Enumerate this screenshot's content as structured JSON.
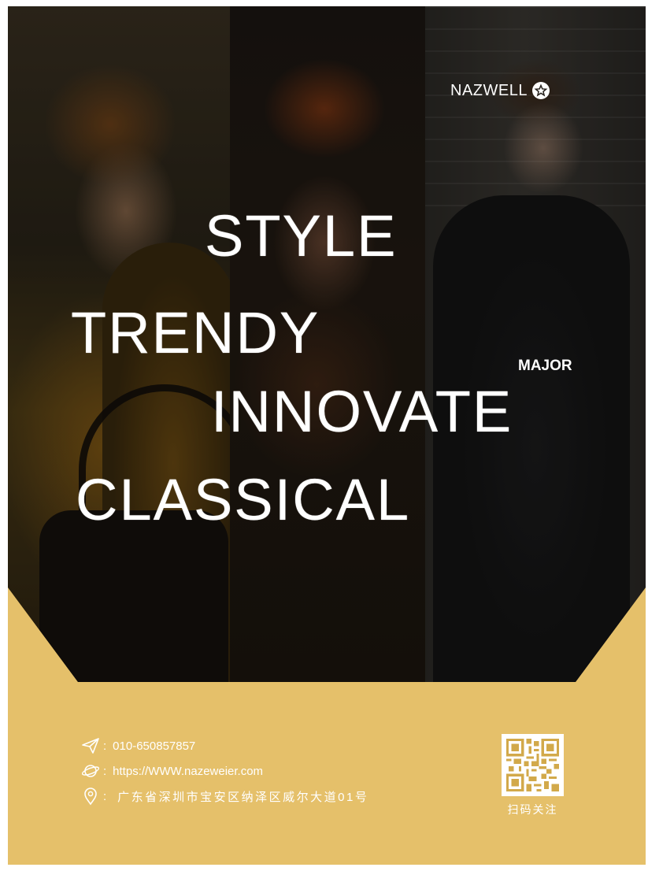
{
  "brand": {
    "name": "NAZWELL",
    "logo_icon": "star-badge-icon"
  },
  "headline": {
    "word_1": "STYLE",
    "word_2": "TRENDY",
    "word_3": "INNOVATE",
    "word_4": "CLASSICAL",
    "tag": "MAJOR"
  },
  "contact": {
    "separator": ":",
    "phone": {
      "icon": "paper-plane-icon",
      "text": "010-650857857"
    },
    "website": {
      "icon": "globe-icon",
      "text": "https://WWW.nazeweier.com"
    },
    "address": {
      "icon": "location-pin-icon",
      "text": "广东省深圳市宝安区纳泽区威尔大道01号"
    }
  },
  "qr": {
    "icon": "qr-code-icon",
    "caption": "扫码关注"
  },
  "colors": {
    "accent": "#e5c06a",
    "text": "#ffffff",
    "photo_dark": "#1a1612"
  }
}
